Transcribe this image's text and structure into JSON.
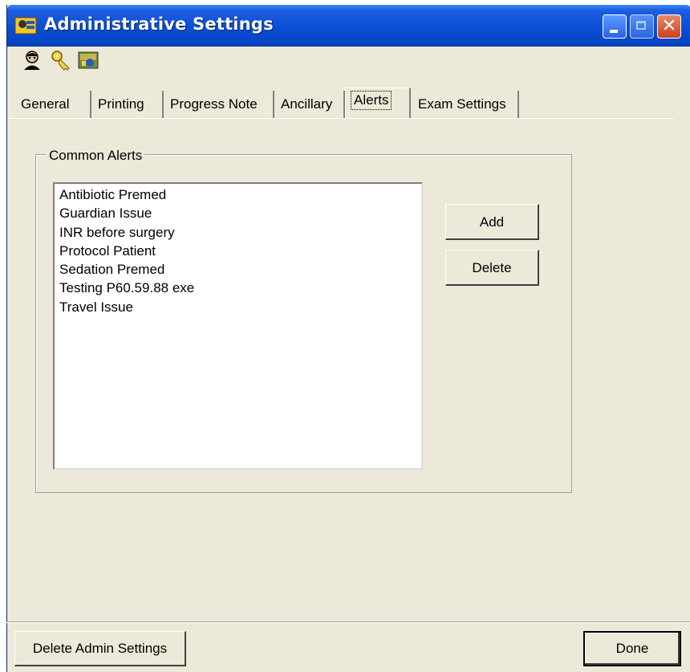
{
  "window": {
    "title": "Administrative Settings"
  },
  "toolbar": {
    "icons": [
      "admin-user-icon",
      "key-icon",
      "image-settings-icon"
    ]
  },
  "tabs": [
    {
      "label": "General"
    },
    {
      "label": "Printing"
    },
    {
      "label": "Progress Note"
    },
    {
      "label": "Ancillary"
    },
    {
      "label": "Alerts",
      "active": true
    },
    {
      "label": "Exam Settings"
    }
  ],
  "alerts": {
    "group_label": "Common Alerts",
    "items": [
      "Antibiotic Premed",
      "Guardian Issue",
      "INR before surgery",
      "Protocol Patient",
      "Sedation Premed",
      "Testing P60.59.88 exe",
      "Travel Issue"
    ],
    "add_label": "Add",
    "delete_label": "Delete"
  },
  "footer": {
    "delete_admin_label": "Delete Admin Settings",
    "done_label": "Done"
  },
  "colors": {
    "titlebar": "#0a50d8",
    "window_bg": "#ece9d8",
    "close_button": "#c8401e"
  }
}
